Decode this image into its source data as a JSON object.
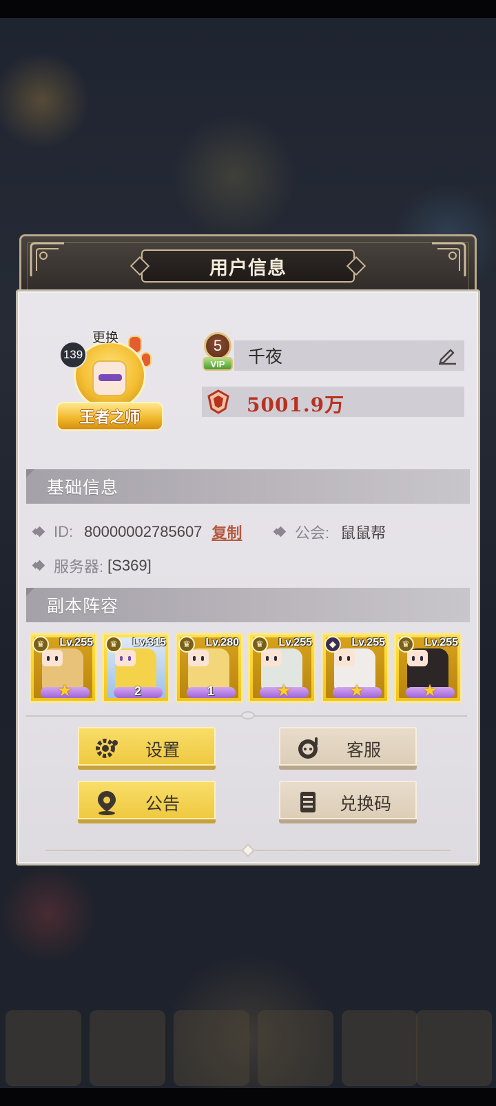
{
  "dialog": {
    "title": "用户信息"
  },
  "profile": {
    "avatar_level": "139",
    "change_label": "更换",
    "avatar_title_badge": "王者之师",
    "vip_level": "5",
    "vip_tag": "VIP",
    "name": "千夜",
    "power": "5001.9万"
  },
  "basic_info": {
    "header": "基础信息",
    "id_label": "ID:",
    "id_value": "80000002785607",
    "copy_label": "复制",
    "guild_label": "公会:",
    "guild_value": "鼠鼠帮",
    "server_label": "服务器:",
    "server_value": "[S369]"
  },
  "lineup": {
    "header": "副本阵容",
    "heroes": [
      {
        "level": "Lv.255",
        "stars": "",
        "faction_icon": "crown-faction-icon"
      },
      {
        "level": "Lv.315",
        "stars": "2",
        "faction_icon": "crown-faction-icon"
      },
      {
        "level": "Lv.280",
        "stars": "1",
        "faction_icon": "crown-faction-icon"
      },
      {
        "level": "Lv.255",
        "stars": "",
        "faction_icon": "crown-faction-icon"
      },
      {
        "level": "Lv.255",
        "stars": "",
        "faction_icon": "dark-faction-icon"
      },
      {
        "level": "Lv.255",
        "stars": "",
        "faction_icon": "crown-faction-icon"
      }
    ]
  },
  "buttons": {
    "settings": "设置",
    "support": "客服",
    "notice": "公告",
    "redeem": "兑换码"
  },
  "icons": {
    "edit": "edit-pencil-icon",
    "power": "power-crest-icon",
    "settings": "gear-icon",
    "support": "headset-icon",
    "notice": "map-pin-icon",
    "redeem": "ticket-book-icon"
  },
  "colors": {
    "power_text": "#b7321f",
    "copy_link": "#b55a3e",
    "button_yellow": "#f2cc45",
    "button_tan": "#e2d4bf"
  }
}
